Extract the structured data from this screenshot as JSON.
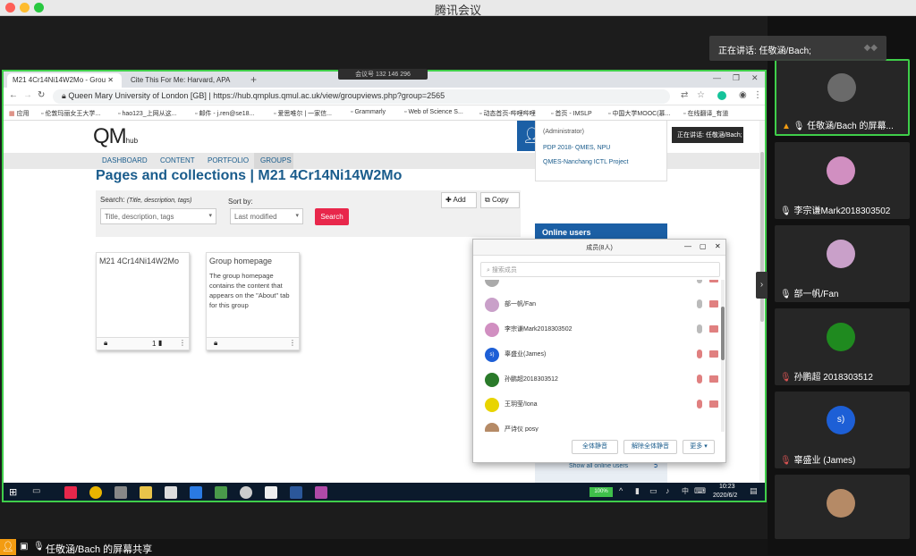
{
  "app_title": "腾讯会议",
  "meeting_id": "会议号 132 146 296",
  "speaking_text": "正在讲话: 任敬涵/Bach;",
  "tooltip_text": "正在讲话: 任敬涵/Bach;",
  "bottom_share_label": "任敬涵/Bach 的屏幕共享",
  "browser": {
    "tabs": [
      {
        "label": "M21 4Cr14Ni14W2Mo - Grou"
      },
      {
        "label": "Cite This For Me: Harvard, APA"
      }
    ],
    "url": "Queen Mary University of London [GB]  |  https://hub.qmplus.qmul.ac.uk/view/groupviews.php?group=2565",
    "bookmarks": [
      "应用",
      "伦敦玛丽女王大学...",
      "hao123_上网从这...",
      "邮件 - j.ren@se18...",
      "爱思唯尔 | 一家信...",
      "Grammarly",
      "Web of Science S...",
      "动态首页-哔哩哔哩",
      "首页 - IMSLP",
      "中国大学MOOC(慕...",
      "在线翻译_有道"
    ]
  },
  "site": {
    "logo": "QM",
    "logo_sub": "hub",
    "nav": [
      "DASHBOARD",
      "CONTENT",
      "PORTFOLIO",
      "GROUPS"
    ],
    "page_title": "Pages and collections | M21 4Cr14Ni14W2Mo",
    "search_label": "Search:",
    "search_hint": "(Title, description, tags)",
    "search_placeholder": "Title, description, tags",
    "sort_label": "Sort by:",
    "sort_value": "Last modified",
    "search_button": "Search",
    "add_button": "Add",
    "copy_button": "Copy",
    "cards": [
      {
        "title": "M21 4Cr14Ni14W2Mo",
        "desc": "",
        "count": "1"
      },
      {
        "title": "Group homepage",
        "desc": "The group homepage contains the content that appears on the \"About\" tab for this group",
        "count": ""
      }
    ],
    "sidebar_links": [
      "(Administrator)",
      "PDP 2018- QMES, NPU",
      "QMES-Nanchang ICTL Project"
    ],
    "online_users": "Online users",
    "show_all": "Show all online users"
  },
  "members_panel": {
    "title": "成员(8人)",
    "search_placeholder": "搜索成员",
    "members": [
      {
        "name": "部一帆/Fan",
        "color": "#c9a0c9"
      },
      {
        "name": "李宗谦Mark2018303502",
        "color": "#d18fc1"
      },
      {
        "name": "辜盛业(James)",
        "color": "#1d5fd6",
        "initial": "s)"
      },
      {
        "name": "孙鹏超2018303512",
        "color": "#2a7a2a"
      },
      {
        "name": "王玥莹/Iona",
        "color": "#e8d400"
      },
      {
        "name": "严诗仪 posy",
        "color": "#b58a66"
      }
    ],
    "mute_all": "全体静音",
    "unmute_all": "解除全体静音",
    "more": "更多"
  },
  "taskbar": {
    "time": "10:23",
    "date": "2020/6/2",
    "battery": "100%",
    "ime": "中"
  },
  "participants": [
    {
      "name": "任敬涵/Bach 的屏幕...",
      "color": "#6a6a6a",
      "active": true
    },
    {
      "name": "李宗谦Mark2018303502",
      "color": "#d18fc1"
    },
    {
      "name": "部一帆/Fan",
      "color": "#c9a0c9"
    },
    {
      "name": "孙鹏超 2018303512",
      "color": "#1f8a1f"
    },
    {
      "name": "辜盛业 (James)",
      "color": "#1d5fd6",
      "initial": "s)"
    },
    {
      "name": "",
      "color": "#b58a66"
    }
  ]
}
